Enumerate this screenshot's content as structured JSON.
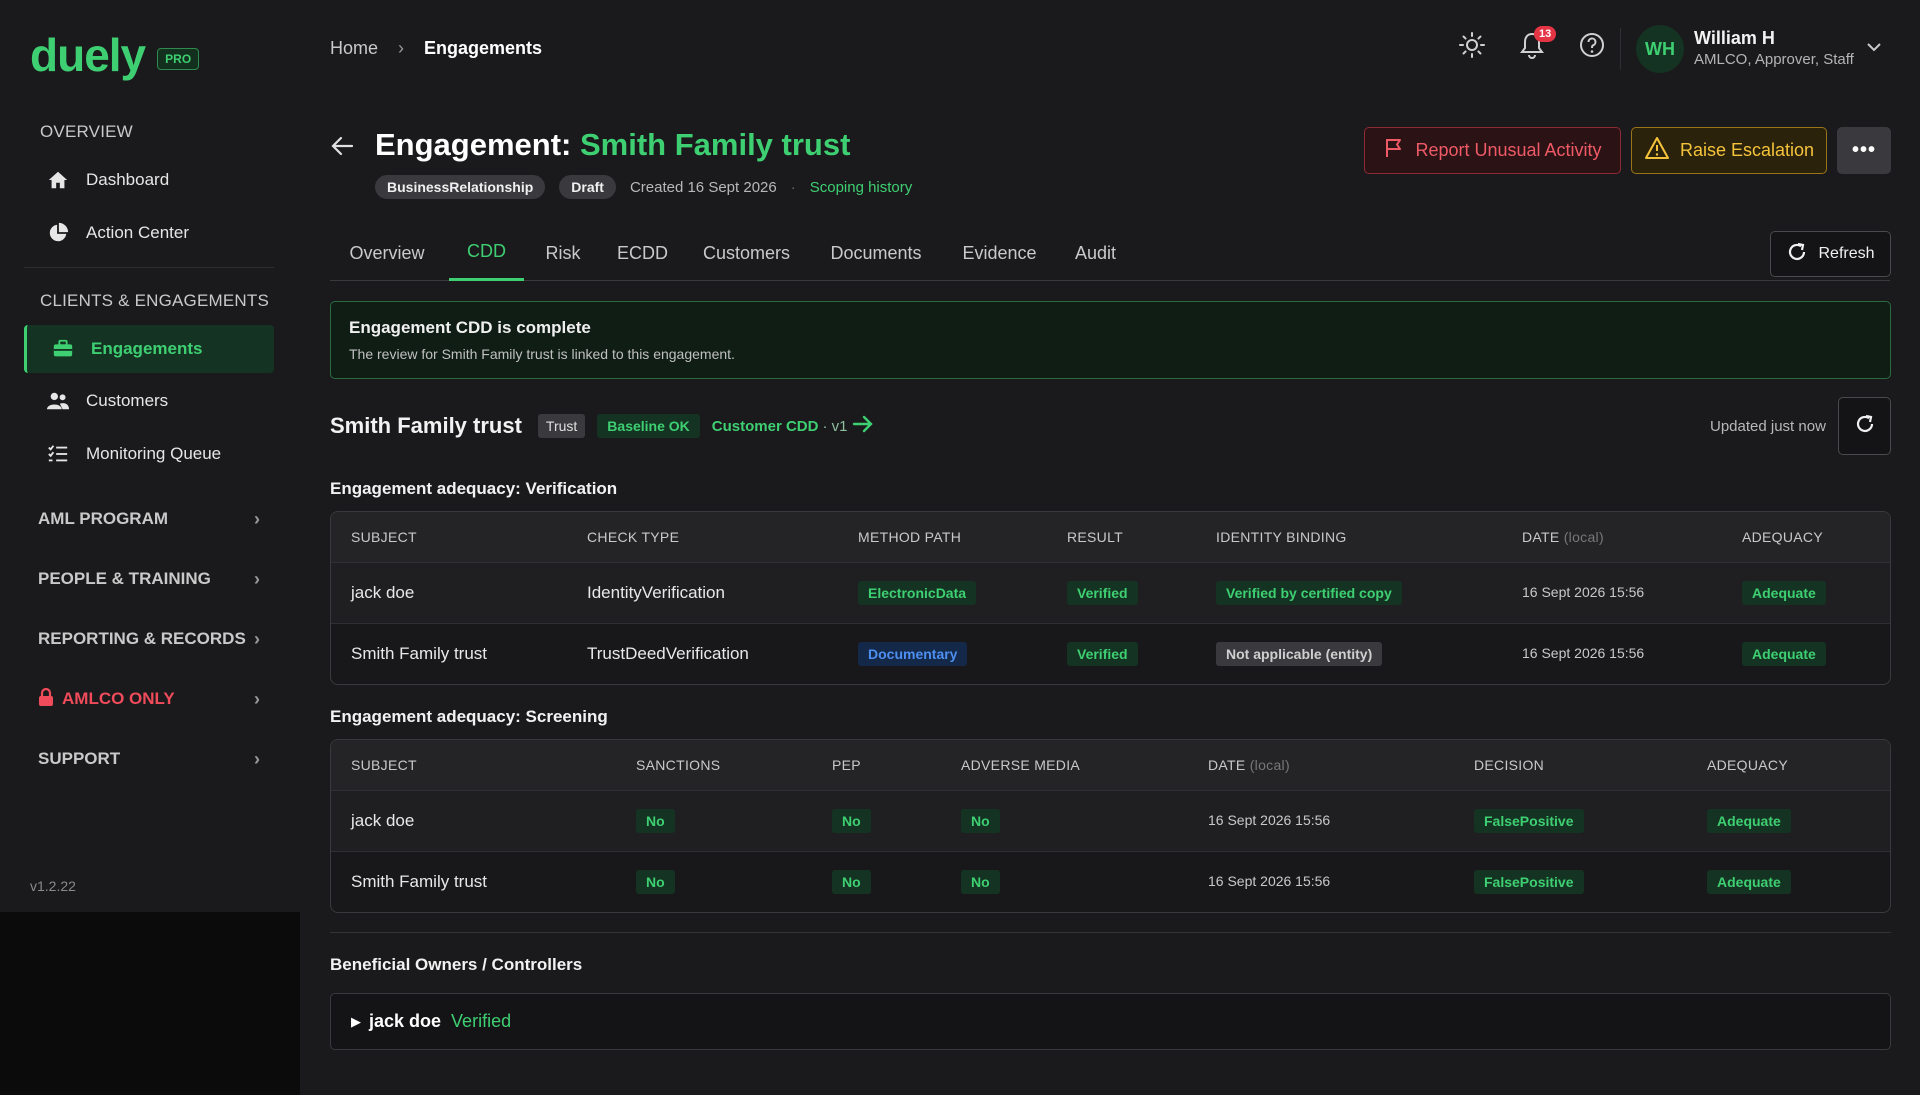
{
  "app": {
    "logo": "duely",
    "plan_badge": "PRO",
    "version": "v1.2.22"
  },
  "sidebar": {
    "overview_label": "OVERVIEW",
    "overview_items": [
      {
        "label": "Dashboard",
        "icon": "home-icon"
      },
      {
        "label": "Action Center",
        "icon": "pie-chart-icon"
      }
    ],
    "clients_label": "CLIENTS & ENGAGEMENTS",
    "clients_items": [
      {
        "label": "Engagements",
        "icon": "briefcase-icon",
        "active": true
      },
      {
        "label": "Customers",
        "icon": "users-icon"
      },
      {
        "label": "Monitoring Queue",
        "icon": "list-check-icon"
      }
    ],
    "groups": [
      {
        "label": "AML PROGRAM"
      },
      {
        "label": "PEOPLE & TRAINING"
      },
      {
        "label": "REPORTING & RECORDS"
      },
      {
        "label": "AMLCO ONLY",
        "icon": "lock-icon",
        "color": "#ef4b5a"
      },
      {
        "label": "SUPPORT"
      }
    ]
  },
  "header": {
    "breadcrumb": {
      "home": "Home",
      "current": "Engagements"
    },
    "notification_count": "13",
    "user": {
      "initials": "WH",
      "name": "William H",
      "role": "AMLCO, Approver, Staff"
    }
  },
  "engagement": {
    "title_prefix": "Engagement:",
    "title_name": "Smith Family trust",
    "type_pill": "BusinessRelationship",
    "status_pill": "Draft",
    "created": "Created 16 Sept 2026",
    "separator": "·",
    "scoping_link": "Scoping history",
    "actions": {
      "report": "Report Unusual Activity",
      "escalate": "Raise Escalation",
      "more": "•••"
    }
  },
  "tabs": [
    "Overview",
    "CDD",
    "Risk",
    "ECDD",
    "Customers",
    "Documents",
    "Evidence",
    "Audit"
  ],
  "active_tab": "CDD",
  "refresh_label": "Refresh",
  "alert": {
    "title": "Engagement CDD is complete",
    "body": "The review for Smith Family trust is linked to this engagement."
  },
  "customer": {
    "name": "Smith Family trust",
    "type_tag": "Trust",
    "baseline_tag": "Baseline OK",
    "cdd_link": "Customer CDD",
    "cdd_version": "· v1",
    "updated": "Updated just now"
  },
  "verification": {
    "title": "Engagement adequacy: Verification",
    "headers": {
      "subject": "SUBJECT",
      "check_type": "CHECK TYPE",
      "method": "METHOD PATH",
      "result": "RESULT",
      "binding": "IDENTITY BINDING",
      "date": "DATE",
      "date_suffix": "(local)",
      "adequacy": "ADEQUACY"
    },
    "rows": [
      {
        "subject": "jack doe",
        "check_type": "IdentityVerification",
        "method": "ElectronicData",
        "result": "Verified",
        "binding": "Verified by certified copy",
        "date": "16 Sept 2026 15:56",
        "adequacy": "Adequate"
      },
      {
        "subject": "Smith Family trust",
        "check_type": "TrustDeedVerification",
        "method": "Documentary",
        "result": "Verified",
        "binding": "Not applicable (entity)",
        "date": "16 Sept 2026 15:56",
        "adequacy": "Adequate"
      }
    ]
  },
  "screening": {
    "title": "Engagement adequacy: Screening",
    "headers": {
      "subject": "SUBJECT",
      "sanctions": "SANCTIONS",
      "pep": "PEP",
      "adverse": "ADVERSE MEDIA",
      "date": "DATE",
      "date_suffix": "(local)",
      "decision": "DECISION",
      "adequacy": "ADEQUACY"
    },
    "rows": [
      {
        "subject": "jack doe",
        "sanctions": "No",
        "pep": "No",
        "adverse": "No",
        "date": "16 Sept 2026 15:56",
        "decision": "FalsePositive",
        "adequacy": "Adequate"
      },
      {
        "subject": "Smith Family trust",
        "sanctions": "No",
        "pep": "No",
        "adverse": "No",
        "date": "16 Sept 2026 15:56",
        "decision": "FalsePositive",
        "adequacy": "Adequate"
      }
    ]
  },
  "beneficial_owners": {
    "title": "Beneficial Owners / Controllers",
    "items": [
      {
        "name": "jack doe",
        "status": "Verified"
      }
    ]
  },
  "colors": {
    "accent": "#3ecf72",
    "danger": "#ef5a66",
    "warning": "#f5c33b",
    "info": "#4d8ff0"
  }
}
